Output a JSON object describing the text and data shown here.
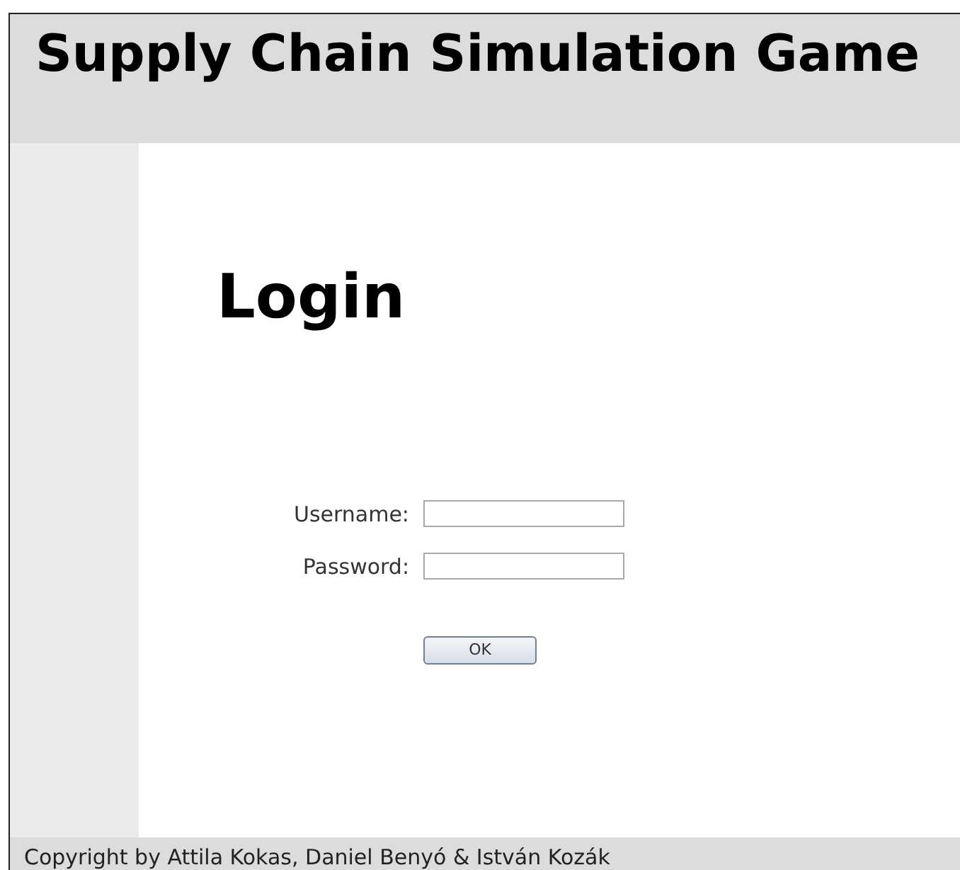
{
  "header": {
    "title": "Supply Chain Simulation Game"
  },
  "login": {
    "heading": "Login",
    "fields": [
      {
        "label": "Username:"
      },
      {
        "label": "Password:"
      }
    ],
    "button": "OK"
  },
  "footer": {
    "text": "Copyright by Attila Kokas, Daniel Benyó & István Kozák"
  }
}
